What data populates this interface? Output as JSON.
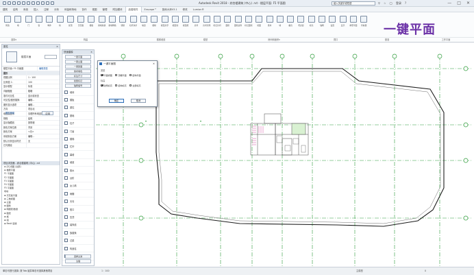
{
  "window": {
    "title": "Autodesk Revit 2018 - 综合楼建筑 (中心) .rvt - 楼层平面: F5 平面图",
    "search_placeholder": "键入关键字或短语",
    "user": "登录",
    "controls": [
      "—",
      "□",
      "✕"
    ]
  },
  "tabs": [
    "建筑",
    "结构",
    "系统",
    "插入",
    "注释",
    "分析",
    "体量和场地",
    "协作",
    "视图",
    "管理",
    "附加模块",
    "品茗软件",
    "Enscape™",
    "族库大师V3.1",
    "修改",
    "Lumion®"
  ],
  "active_tab_index": 11,
  "ribbon": {
    "buttons": [
      "修改",
      "墙",
      "门",
      "窗",
      "构件",
      "柱",
      "屋顶",
      "天花板",
      "楼板",
      "幕墙系统",
      "幕墙网格",
      "竖梃",
      "栏杆扶手",
      "坡道",
      "楼梯",
      "模型文字",
      "模型线",
      "模型组",
      "房间",
      "房间分隔",
      "标记房间",
      "面积",
      "面积边界",
      "标记面积",
      "按面",
      "竖井",
      "墙",
      "垂直",
      "老虎窗",
      "标高",
      "轴网",
      "设置",
      "显示",
      "参照平面",
      "查看器"
    ],
    "groups": [
      "选择▾",
      "构建",
      "楼梯坡道",
      "模型",
      "房间和面积▾",
      "洞口",
      "基准",
      "工作平面"
    ],
    "overlay_text": "一键平面"
  },
  "properties": {
    "header": "属性",
    "type_name": "楼层平面",
    "type_dropdown": "",
    "selector": "楼层平面: F5 平面图",
    "edit_type": "编辑类型",
    "rows": [
      {
        "k": "图形",
        "v": "",
        "section": true
      },
      {
        "k": "视图比例",
        "v": "1 : 100"
      },
      {
        "k": "比例值 1:",
        "v": "100"
      },
      {
        "k": "显示模型",
        "v": "标准"
      },
      {
        "k": "详细程度",
        "v": "粗略"
      },
      {
        "k": "零件可见性",
        "v": "显示原状态"
      },
      {
        "k": "可见性/图形替换",
        "v": "编辑..."
      },
      {
        "k": "图形显示选项",
        "v": "编辑..."
      },
      {
        "k": "方向",
        "v": "项目北"
      },
      {
        "k": "墙连接显示",
        "v": "清理所有墙连接"
      },
      {
        "k": "规程",
        "v": "建筑"
      },
      {
        "k": "显示隐藏线",
        "v": "按规程"
      },
      {
        "k": "颜色方案位置",
        "v": "背景"
      },
      {
        "k": "颜色方案",
        "v": "<无>"
      },
      {
        "k": "系统颜色方案",
        "v": "编辑..."
      },
      {
        "k": "默认分析显示样式",
        "v": "无"
      },
      {
        "k": "日光路径",
        "v": ""
      }
    ],
    "help_link": "属性帮助",
    "apply": "应用"
  },
  "browser": {
    "header": "项目浏览器 - 综合楼建筑 (中心) .rvt",
    "items": [
      "⊟ [0] 视图 (全部)",
      "  ⊟ 楼层平面",
      "    F1 平面图",
      "    F2 平面图",
      "    F3 平面图",
      "    F4 平面图",
      "    F5 平面图",
      "    场地",
      "  ⊞ 天花板平面",
      "  ⊞ 三维视图",
      "  ⊞ 立面",
      "⊞ 图例",
      "⊞ 明细表/数量",
      "⊞ 图纸",
      "⊞ 族",
      "⊞ 组",
      "⊞ Revit 链接"
    ]
  },
  "toolbox": {
    "header": "快速建模",
    "buttons": [
      "一键平面",
      "一键立面",
      "一键剖面",
      "房间填色",
      "标注尺寸",
      "批量标记",
      "轴网编号"
    ],
    "items": [
      "墙体",
      "楼板",
      "梁柱",
      "基础",
      "柱子",
      "门窗",
      "楼梯",
      "栏杆",
      "幕墙",
      "坡道",
      "散水",
      "台阶",
      "女儿墙",
      "雨棚",
      "天沟",
      "檐口",
      "压顶",
      "装饰线",
      "族替换",
      "过梁",
      "构造柱",
      "圈梁"
    ],
    "bottom_buttons": [
      "选择过滤",
      "清理"
    ]
  },
  "dialog": {
    "title": "一键平面图",
    "section1_label": "类型",
    "row1": [
      {
        "label": "平面视图",
        "checked": true
      },
      {
        "label": "顶棚平面",
        "checked": false
      },
      {
        "label": "结构平面",
        "checked": false
      }
    ],
    "section2_label": "标高",
    "row2": [
      {
        "label": "建筑标高",
        "checked": true
      },
      {
        "label": "结构标高",
        "checked": false
      },
      {
        "label": "全部标高",
        "checked": false
      }
    ],
    "ok": "确定",
    "cancel": "取消"
  },
  "status": {
    "left": "单击可进行选择; 按 Tab 键并单击可选择其他项目",
    "scale": "1 : 100",
    "right": "主模型",
    "coords": "0"
  }
}
